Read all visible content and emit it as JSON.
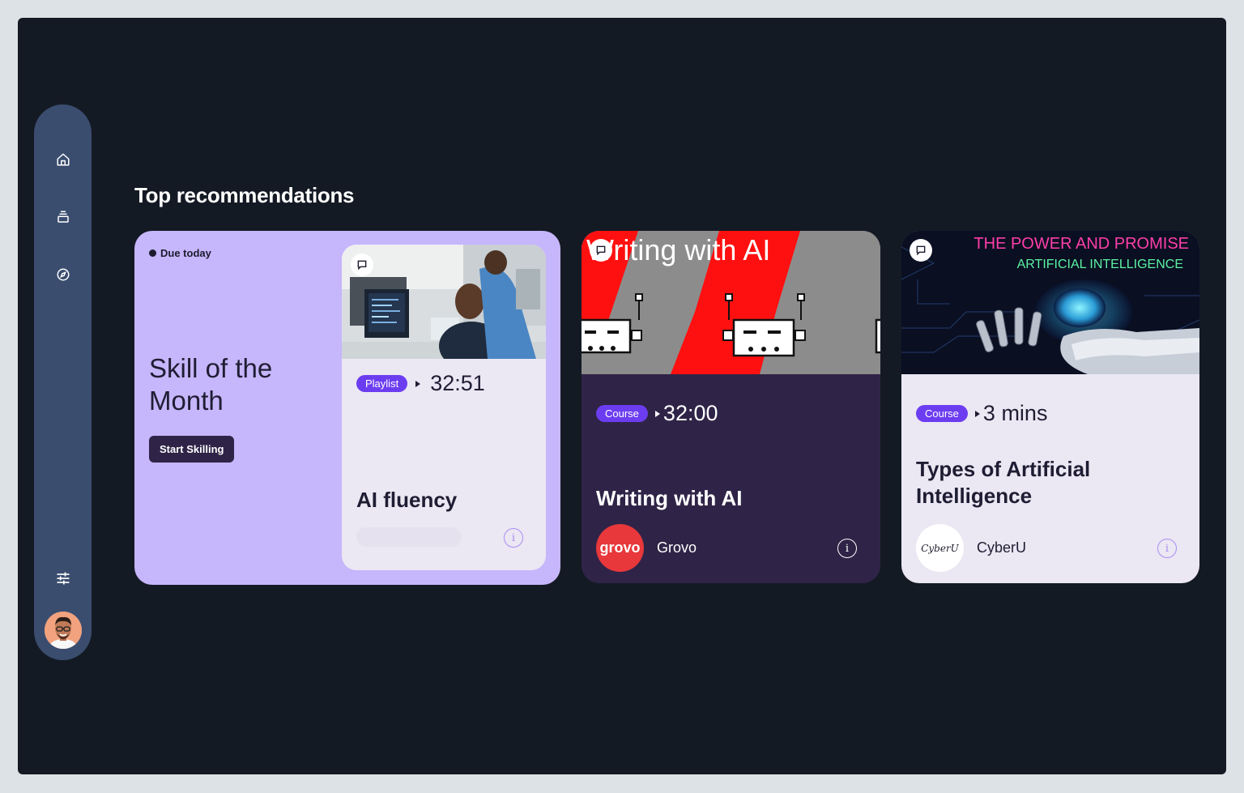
{
  "sidebar": {
    "items": [
      {
        "name": "home",
        "icon": "home-icon"
      },
      {
        "name": "library",
        "icon": "stack-icon"
      },
      {
        "name": "explore",
        "icon": "compass-icon"
      },
      {
        "name": "filters",
        "icon": "sliders-icon"
      }
    ],
    "avatar_icon": "user-avatar"
  },
  "section": {
    "title": "Top recommendations"
  },
  "cards": [
    {
      "due_label": "Due today",
      "title": "Skill of the Month",
      "button_label": "Start Skilling",
      "inner": {
        "type_label": "Playlist",
        "duration": "32:51",
        "title": "AI fluency",
        "progress": 0
      }
    },
    {
      "image_text": "Writing with AI",
      "type_label": "Course",
      "duration": "32:00",
      "title": "Writing with AI",
      "provider_name": "Grovo",
      "provider_logo_text": "grovo"
    },
    {
      "image_text_line1": "THE POWER AND PROMISE",
      "image_text_line2": "ARTIFICIAL INTELLIGENCE",
      "type_label": "Course",
      "duration": "3 mins",
      "title": "Types of Artificial Intelligence",
      "provider_name": "CyberU",
      "provider_logo_text": "CyberU"
    }
  ],
  "colors": {
    "page_bg": "#141a24",
    "sidebar": "#3a4d6f",
    "card_lavender": "#c6b6fb",
    "card_dark_purple": "#2f2447",
    "chip_purple": "#6c3df0",
    "grovo_red": "#e8383b",
    "neon_pink": "#ff3fa8",
    "neon_green": "#5cf2a3"
  }
}
